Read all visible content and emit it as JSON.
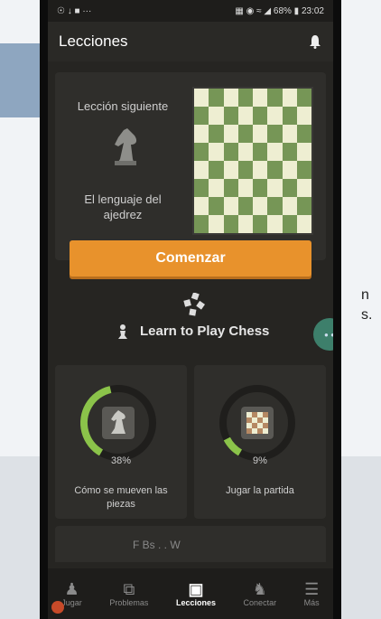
{
  "background": {
    "text_lines": [
      "n",
      "s."
    ]
  },
  "status_bar": {
    "left_icons": "☉ ↓ ■ ···",
    "right_text": "▦ ◉ ≈ ◢ 68% ▮ 23:02"
  },
  "app_bar": {
    "title": "Lecciones"
  },
  "next_lesson": {
    "label": "Lección siguiente",
    "name": "El lenguaje del ajedrez",
    "start_button": "Comenzar"
  },
  "course": {
    "title": "Learn to Play Chess"
  },
  "lessons": [
    {
      "title": "Cómo se mueven las piezas",
      "progress_label": "38%",
      "progress": 0.38,
      "icon": "knight-hand-icon"
    },
    {
      "title": "Jugar la partida",
      "progress_label": "9%",
      "progress": 0.09,
      "icon": "board-icon"
    }
  ],
  "peek_card": {
    "text": "F Bs . . W"
  },
  "nav": [
    {
      "label": "Jugar",
      "icon": "pawn-flag-icon",
      "active": false
    },
    {
      "label": "Problemas",
      "icon": "puzzle-icon",
      "active": false
    },
    {
      "label": "Lecciones",
      "icon": "lessons-icon",
      "active": true
    },
    {
      "label": "Conectar",
      "icon": "people-icon",
      "active": false
    },
    {
      "label": "Más",
      "icon": "menu-icon",
      "active": false
    }
  ],
  "colors": {
    "accent": "#e8922c",
    "progress": "#8bc34a",
    "board_light": "#eeeed2",
    "board_dark": "#769656"
  }
}
